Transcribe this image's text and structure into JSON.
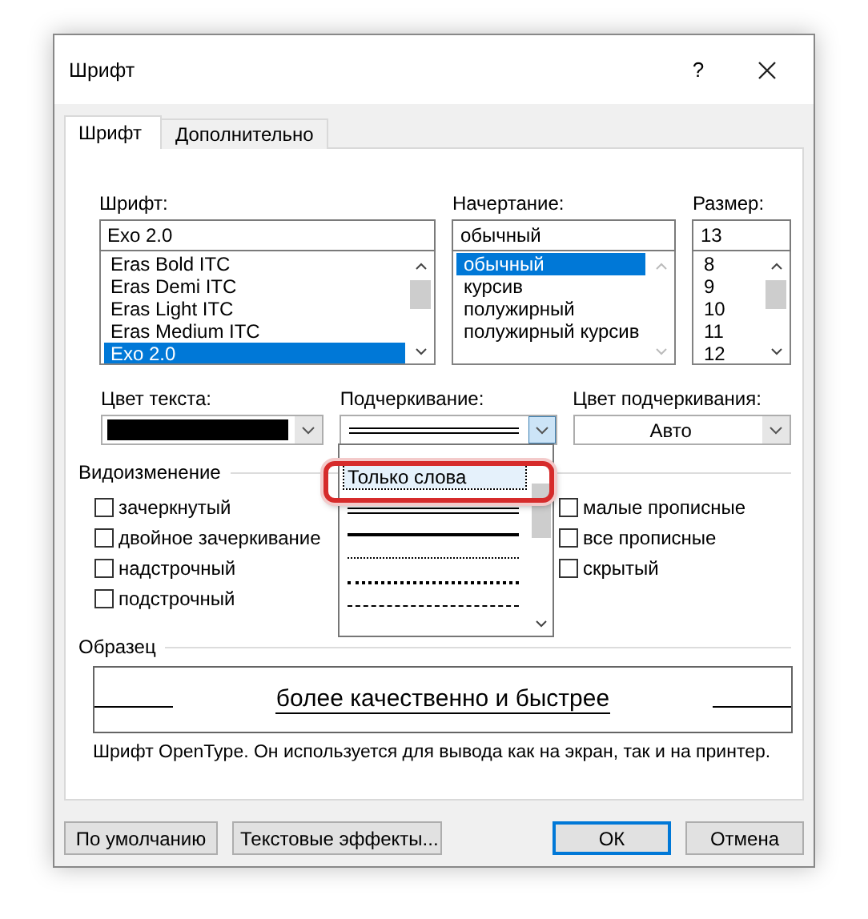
{
  "window": {
    "title": "Шрифт",
    "help": "?"
  },
  "tabs": [
    {
      "label": "Шрифт",
      "selected": true
    },
    {
      "label": "Дополнительно",
      "selected": false
    }
  ],
  "font": {
    "label": "Шрифт:",
    "value": "Exo 2.0",
    "items": [
      {
        "label": "Eras Bold ITC",
        "selected": false
      },
      {
        "label": "Eras Demi ITC",
        "selected": false
      },
      {
        "label": "Eras Light ITC",
        "selected": false
      },
      {
        "label": "Eras Medium ITC",
        "selected": false
      },
      {
        "label": "Exo 2.0",
        "selected": true
      }
    ]
  },
  "style": {
    "label": "Начертание:",
    "value": "обычный",
    "items": [
      {
        "label": "обычный",
        "selected": true
      },
      {
        "label": "курсив",
        "selected": false
      },
      {
        "label": "полужирный",
        "selected": false
      },
      {
        "label": "полужирный курсив",
        "selected": false
      }
    ]
  },
  "size": {
    "label": "Размер:",
    "value": "13",
    "items": [
      {
        "label": "8",
        "selected": false
      },
      {
        "label": "9",
        "selected": false
      },
      {
        "label": "10",
        "selected": false
      },
      {
        "label": "11",
        "selected": false
      },
      {
        "label": "12",
        "selected": false
      }
    ]
  },
  "text_color": {
    "label": "Цвет текста:",
    "color": "#000000"
  },
  "underline": {
    "label": "Подчеркивание:",
    "kind": "double",
    "open": true
  },
  "underline_color": {
    "label": "Цвет подчеркивания:",
    "value": "Авто"
  },
  "underline_options": [
    {
      "kind": "text",
      "label": "Только слова",
      "selected": true
    },
    {
      "kind": "double",
      "selected": false
    },
    {
      "kind": "thick",
      "selected": false
    },
    {
      "kind": "dotted",
      "selected": false
    },
    {
      "kind": "dotted_heavy",
      "selected": false
    },
    {
      "kind": "dashed",
      "selected": false
    }
  ],
  "effects": {
    "label": "Видоизменение",
    "left": [
      {
        "label": "зачеркнутый",
        "checked": false
      },
      {
        "label": "двойное зачеркивание",
        "checked": false
      },
      {
        "label": "надстрочный",
        "checked": false
      },
      {
        "label": "подстрочный",
        "checked": false
      }
    ],
    "right": [
      {
        "label": "малые прописные",
        "checked": false
      },
      {
        "label": "все прописные",
        "checked": false
      },
      {
        "label": "скрытый",
        "checked": false
      }
    ]
  },
  "sample": {
    "label": "Образец",
    "text": "более качественно и быстрее",
    "description": "Шрифт OpenType. Он используется для вывода как на экран, так и на принтер."
  },
  "buttons": [
    {
      "label": "По умолчанию",
      "default": false
    },
    {
      "label": "Текстовые эффекты...",
      "default": false
    },
    {
      "label": "ОК",
      "default": true
    },
    {
      "label": "Отмена",
      "default": false
    }
  ]
}
